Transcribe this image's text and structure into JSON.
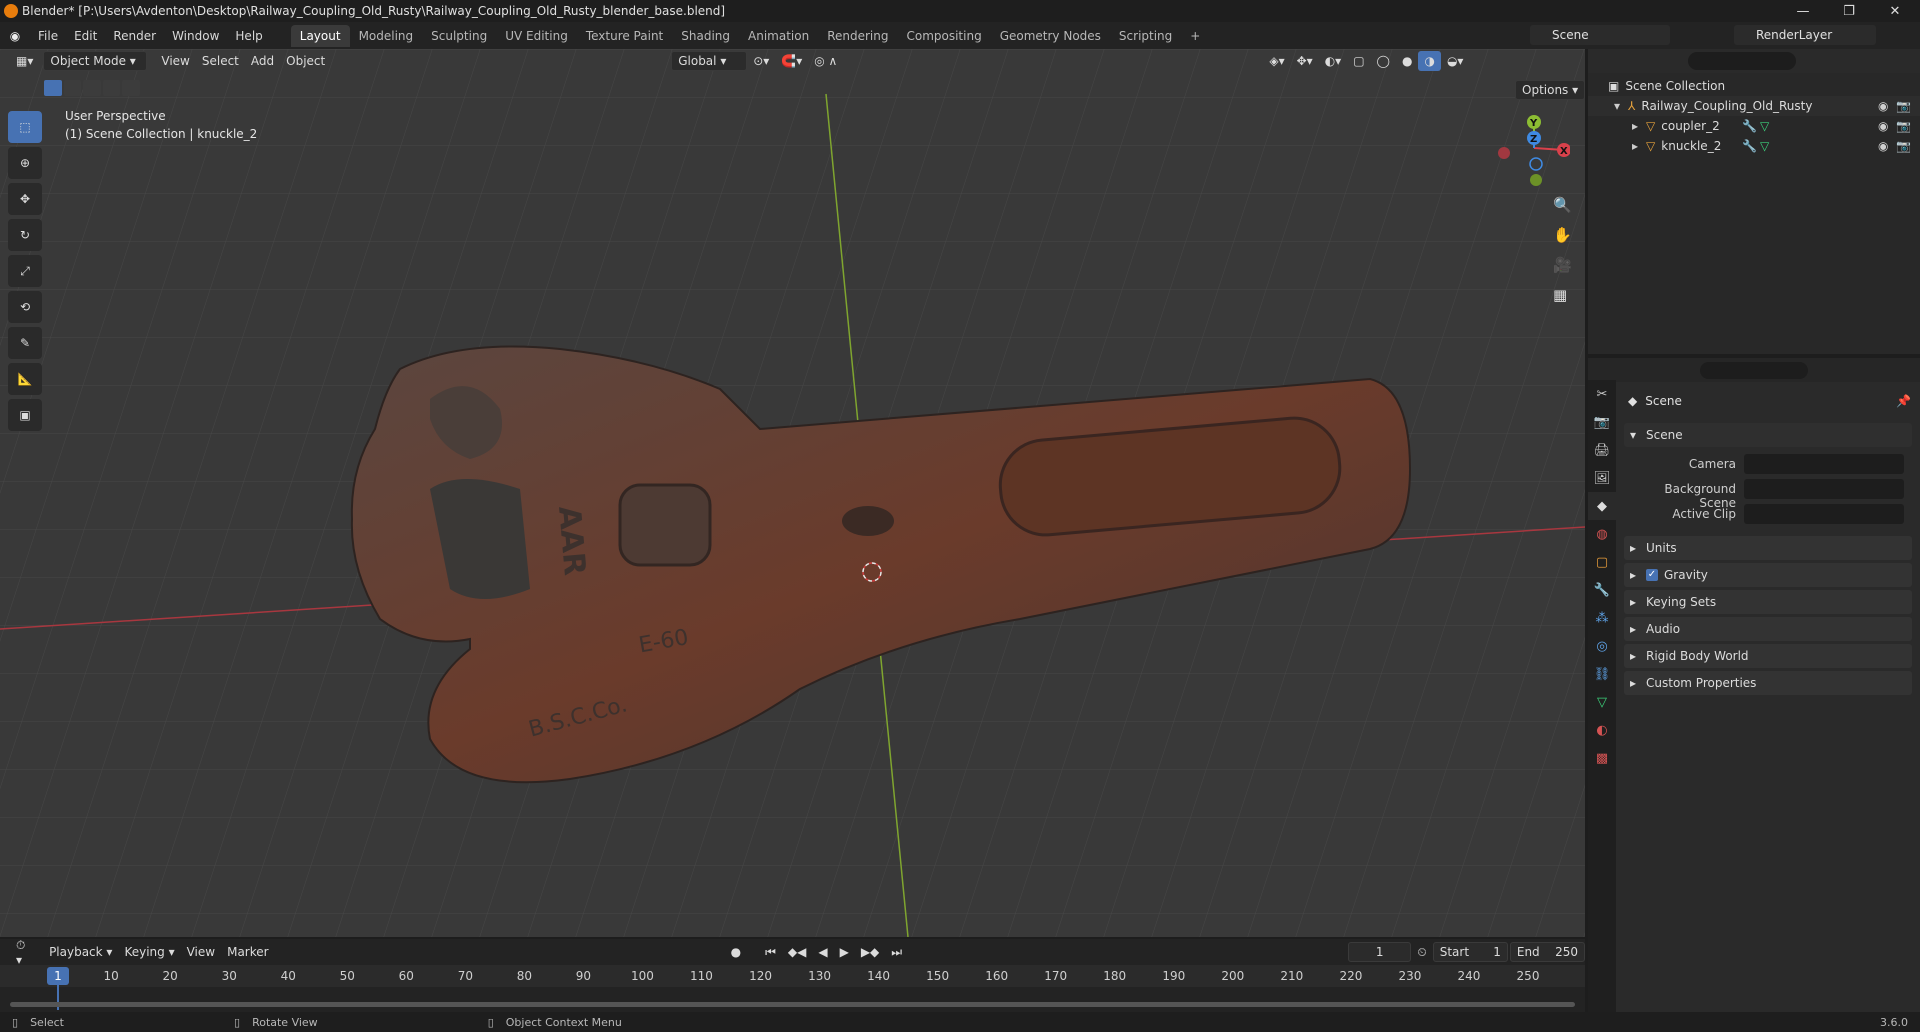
{
  "window": {
    "title": "Blender* [P:\\Users\\Avdenton\\Desktop\\Railway_Coupling_Old_Rusty\\Railway_Coupling_Old_Rusty_blender_base.blend]",
    "min": "—",
    "max": "❐",
    "close": "✕"
  },
  "menu": [
    "File",
    "Edit",
    "Render",
    "Window",
    "Help"
  ],
  "workspaces": [
    "Layout",
    "Modeling",
    "Sculpting",
    "UV Editing",
    "Texture Paint",
    "Shading",
    "Animation",
    "Rendering",
    "Compositing",
    "Geometry Nodes",
    "Scripting"
  ],
  "active_workspace": "Layout",
  "scene_name": "Scene",
  "render_layer": "RenderLayer",
  "viewport": {
    "mode": "Object Mode",
    "menus": [
      "View",
      "Select",
      "Add",
      "Object"
    ],
    "transform_orientation": "Global",
    "options_label": "Options",
    "perspective": "User Perspective",
    "context": "(1) Scene Collection | knuckle_2",
    "gizmo": {
      "x": "X",
      "y": "Y",
      "z": "Z"
    },
    "object_stamps": [
      "AAR",
      "E-60",
      "B.S.C.Co."
    ]
  },
  "outliner": {
    "root": "Scene Collection",
    "collection": "Railway_Coupling_Old_Rusty",
    "objects": [
      "coupler_2",
      "knuckle_2"
    ]
  },
  "properties": {
    "header": "Scene",
    "panel_scene": "Scene",
    "fields": {
      "camera": "Camera",
      "background_scene": "Background Scene",
      "active_clip": "Active Clip"
    },
    "panels": [
      "Units",
      "Gravity",
      "Keying Sets",
      "Audio",
      "Rigid Body World",
      "Custom Properties"
    ],
    "gravity_checked": true
  },
  "timeline": {
    "menus": [
      "Playback",
      "Keying",
      "View",
      "Marker"
    ],
    "current_frame": "1",
    "start_label": "Start",
    "start": "1",
    "end_label": "End",
    "end": "250",
    "ticks": [
      "1",
      "10",
      "20",
      "30",
      "40",
      "50",
      "60",
      "70",
      "80",
      "90",
      "100",
      "110",
      "120",
      "130",
      "140",
      "150",
      "160",
      "170",
      "180",
      "190",
      "200",
      "210",
      "220",
      "230",
      "240",
      "250"
    ]
  },
  "status": {
    "select": "Select",
    "rotate": "Rotate View",
    "context_menu": "Object Context Menu",
    "version": "3.6.0"
  },
  "colors": {
    "accent": "#4772b3",
    "x_axis": "#d9414b",
    "y_axis": "#8cbd33",
    "z_axis": "#3f8ae2",
    "rust": "#6e3e2c"
  }
}
